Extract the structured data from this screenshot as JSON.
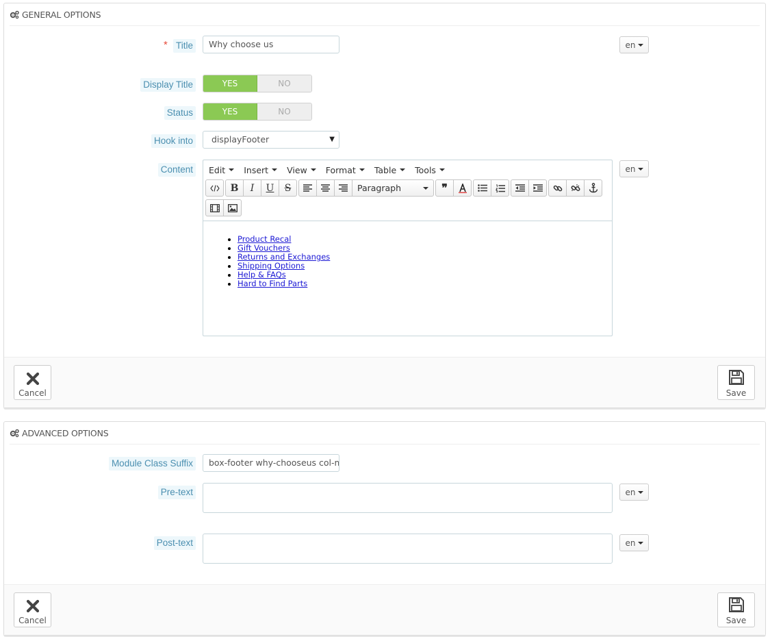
{
  "general": {
    "heading": "GENERAL OPTIONS",
    "required_mark": "*",
    "title": {
      "label": "Title",
      "value": "Why choose us",
      "lang": "en"
    },
    "display_title": {
      "label": "Display Title",
      "yes": "YES",
      "no": "NO",
      "selected": "YES"
    },
    "status": {
      "label": "Status",
      "yes": "YES",
      "no": "NO",
      "selected": "YES"
    },
    "hook": {
      "label": "Hook into",
      "value": "displayFooter"
    },
    "content": {
      "label": "Content",
      "lang": "en",
      "menus": [
        "Edit",
        "Insert",
        "View",
        "Format",
        "Table",
        "Tools"
      ],
      "format_value": "Paragraph",
      "links": [
        "Product Recal",
        "Gift Vouchers",
        "Returns and Exchanges",
        "Shipping Options",
        "Help & FAQs",
        "Hard to Find Parts"
      ]
    },
    "cancel_label": "Cancel",
    "save_label": "Save"
  },
  "advanced": {
    "heading": "ADVANCED OPTIONS",
    "suffix": {
      "label": "Module Class Suffix",
      "value": "box-footer why-chooseus col-md"
    },
    "pretext": {
      "label": "Pre-text",
      "value": "",
      "lang": "en"
    },
    "posttext": {
      "label": "Post-text",
      "value": "",
      "lang": "en"
    },
    "cancel_label": "Cancel",
    "save_label": "Save"
  }
}
